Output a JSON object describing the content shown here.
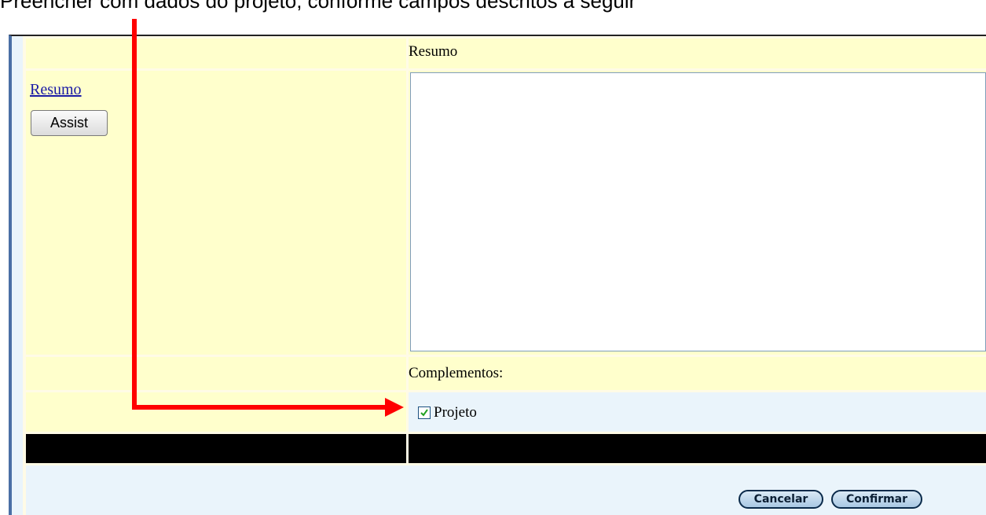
{
  "caption": "Preencher com dados do projeto, conforme campos descritos a seguir",
  "form": {
    "section_header": "Resumo",
    "field_link": "Resumo",
    "assist_button": "Assist",
    "textarea_value": "",
    "complementos_label": "Complementos:",
    "projeto_label": "Projeto",
    "projeto_checked": true
  },
  "footer": {
    "cancel_label": "Cancelar",
    "confirm_label": "Confirmar"
  },
  "annotation": {
    "arrow_color": "#ff0000"
  },
  "colors": {
    "label_bg": "#ffffcc",
    "value_bg": "#eaf4fb",
    "bar": "#000000",
    "link": "#1a1aa6"
  }
}
